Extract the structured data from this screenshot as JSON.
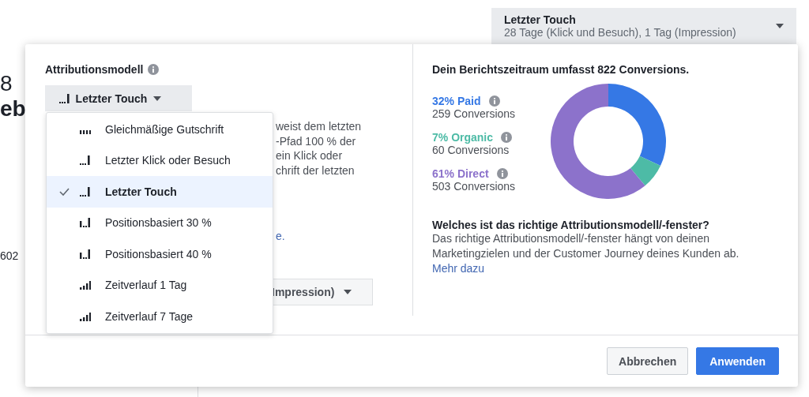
{
  "page_behind": {
    "window_dropdown": {
      "title": "Letzter Touch",
      "subtitle": "28 Tage (Klick und Besuch), 1 Tag (Impression)"
    },
    "left_texts": [
      {
        "text": "8",
        "kind": "large"
      },
      {
        "text": "eb",
        "kind": "bold"
      },
      {
        "text": "602",
        "kind": "small"
      }
    ]
  },
  "dialog": {
    "model_label": "Attributionsmodell",
    "model_dropdown": {
      "label": "Letzter Touch",
      "kind": "last"
    },
    "model_menu": [
      {
        "label": "Gleichmäßige Gutschrift",
        "kind": "even",
        "selected": false
      },
      {
        "label": "Letzter Klick oder Besuch",
        "kind": "last",
        "selected": false
      },
      {
        "label": "Letzter Touch",
        "kind": "last",
        "selected": true
      },
      {
        "label": "Positionsbasiert 30 %",
        "kind": "position",
        "selected": false
      },
      {
        "label": "Positionsbasiert 40 %",
        "kind": "position",
        "selected": false
      },
      {
        "label": "Zeitverlauf 1 Tag",
        "kind": "time",
        "selected": false
      },
      {
        "label": "Zeitverlauf 7 Tage",
        "kind": "time",
        "selected": false
      }
    ],
    "description_lines": [
      "weist dem letzten",
      "-Pfad 100 % der",
      "ein Klick oder",
      "chrift der letzten"
    ],
    "description_link": "e.",
    "window_dropdown": {
      "label": "Impression)"
    },
    "summary": {
      "title": "Dein Berichtszeitraum umfasst 822 Conversions.",
      "legend": [
        {
          "share": "32%",
          "count": "259 Conversions",
          "color": "#3578e5"
        },
        {
          "share": "7%",
          "count": "60 Conversions",
          "color": "#4dbba6"
        },
        {
          "share": "61%",
          "count": "503 Conversions",
          "color": "#8c72cb"
        }
      ],
      "chart_data": {
        "type": "donut",
        "categories": [
          "Paid",
          "Organic",
          "Direct"
        ],
        "values": [
          32,
          7,
          61
        ]
      }
    },
    "help": {
      "title": "Welches ist das richtige Attributionsmodell/-fenster?",
      "text": "Das richtige Attributionsmodell/-fenster hängt von deinen Marketingzielen und der Customer Journey deines Kunden ab.",
      "link": "Mehr dazu"
    },
    "buttons": [
      {
        "label": "Abbrechen",
        "kind": "secondary"
      },
      {
        "label": "Anwenden",
        "kind": "primary"
      }
    ]
  }
}
